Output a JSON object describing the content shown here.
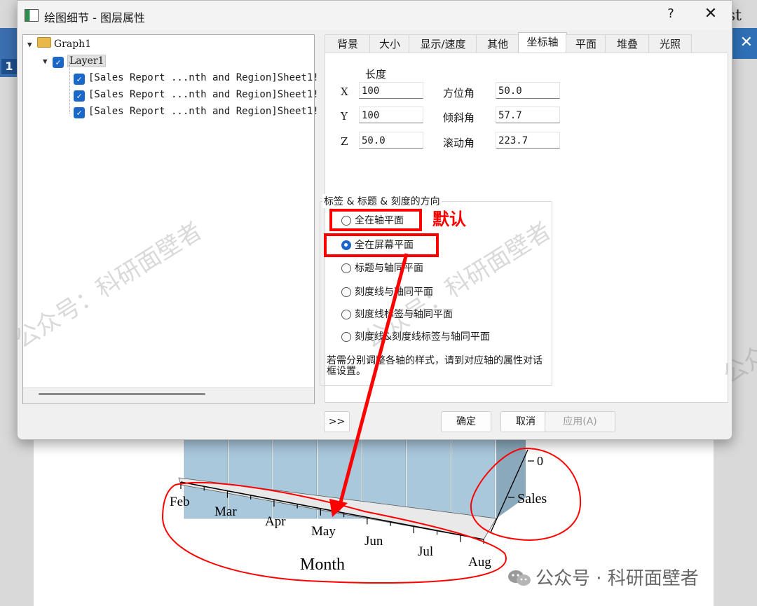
{
  "background": {
    "corner_text": "st",
    "badge_number": "1",
    "close_glyph": "✕"
  },
  "dialog": {
    "title": "绘图细节 - 图层属性",
    "help": "?",
    "close": "✕"
  },
  "tree": {
    "root": "Graph1",
    "layer": "Layer1",
    "items": [
      "[Sales Report ...nth and Region]Sheet1! '",
      "[Sales Report ...nth and Region]Sheet1! '",
      "[Sales Report ...nth and Region]Sheet1! '"
    ]
  },
  "tabs": [
    "背景",
    "大小",
    "显示/速度",
    "其他",
    "坐标轴",
    "平面",
    "堆叠",
    "光照"
  ],
  "active_tab": "坐标轴",
  "axis_panel": {
    "length_label": "长度",
    "x_label": "X",
    "x_value": "100",
    "y_label": "Y",
    "y_value": "100",
    "z_label": "Z",
    "z_value": "50.0",
    "azimuth_label": "方位角",
    "azimuth_value": "50.0",
    "tilt_label": "倾斜角",
    "tilt_value": "57.7",
    "roll_label": "滚动角",
    "roll_value": "223.7",
    "orientation_group_title": "标签 & 标题 & 刻度的方向",
    "options": [
      "全在轴平面",
      "全在屏幕平面",
      "标题与轴同平面",
      "刻度线与轴同平面",
      "刻度线标签与轴同平面",
      "刻度线&刻度线标签与轴同平面"
    ],
    "selected_option_index": 1,
    "note": "若需分别调整各轴的样式，请到对应轴的属性对话框设置。"
  },
  "buttons": {
    "expand": ">>",
    "ok": "确定",
    "cancel": "取消",
    "apply": "应用(A)"
  },
  "annotation": {
    "default_label": "默认",
    "color": "#ff0000"
  },
  "watermark": {
    "text": "公众号：科研面壁者",
    "brand": "公众号 · 科研面壁者"
  },
  "chart_data": {
    "type": "bar",
    "categories": [
      "Feb",
      "Mar",
      "Apr",
      "May",
      "Jun",
      "Jul",
      "Aug"
    ],
    "xlabel": "Month",
    "zlabel": "Sales",
    "z_tick_visible": "0",
    "bar_color": "#a9c8dc"
  }
}
